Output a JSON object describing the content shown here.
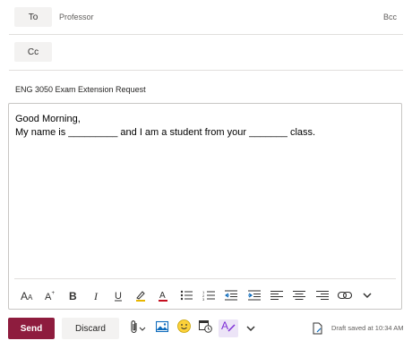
{
  "header": {
    "to_label": "To",
    "to_value": "Professor",
    "bcc_label": "Bcc",
    "cc_label": "Cc",
    "subject": "ENG 3050 Exam Extension Request"
  },
  "body": {
    "line1": "Good Morning,",
    "line2": "My name is _________ and I am a student from your _______ class."
  },
  "format_toolbar": {
    "icons": [
      "font-size-decrease-icon",
      "font-size-increase-icon",
      "bold-icon",
      "italic-icon",
      "underline-icon",
      "highlight-icon",
      "font-color-icon",
      "bulleted-list-icon",
      "numbered-list-icon",
      "decrease-indent-icon",
      "increase-indent-icon",
      "align-left-icon",
      "align-center-icon",
      "align-right-icon",
      "insert-link-icon",
      "more-options-chevron-icon"
    ],
    "labels": {
      "bold": "B",
      "italic": "I",
      "underline": "U",
      "font_color": "A"
    }
  },
  "footer": {
    "send_label": "Send",
    "discard_label": "Discard",
    "draft_status": "Draft saved at 10:34 AM"
  },
  "colors": {
    "send_button": "#8e1c3e",
    "highlight_accent": "#e8b600",
    "font_color_accent": "#c50f1f",
    "editor_accent": "#7b2ad6"
  }
}
